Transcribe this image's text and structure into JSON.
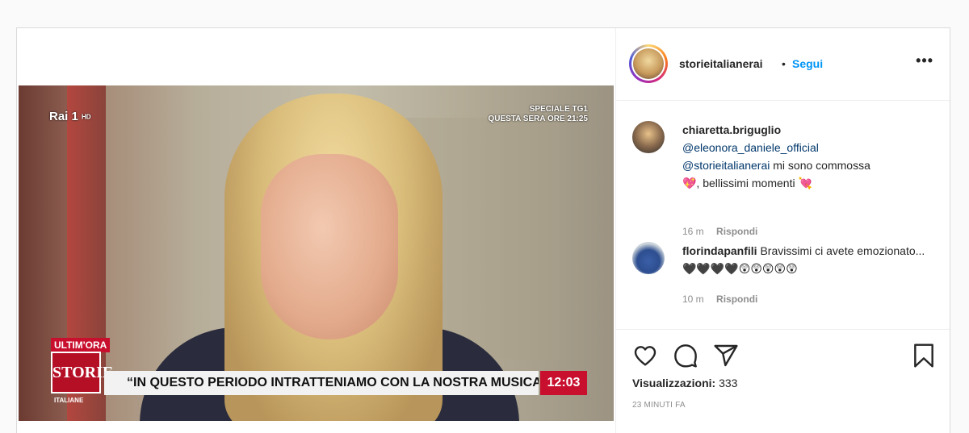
{
  "video": {
    "channel_logo": "Rai 1",
    "channel_hd": "HD",
    "special_line1": "SPECIALE TG1",
    "special_line2": "QUESTA SERA ORE 21:25",
    "breaking_label": "ULTIM'ORA",
    "show_logo": "STORIE",
    "show_logo_sub": "ITALIANE",
    "ticker_text": "“IN QUESTO PERIODO INTRATTENIAMO CON LA NOSTRA MUSICA”",
    "clock": "12:03"
  },
  "header": {
    "username": "storieitalianerai",
    "separator": "•",
    "follow_label": "Segui",
    "more_label": "•••"
  },
  "comments": [
    {
      "user": "chiaretta.briguglio",
      "mention1": "@eleonora_daniele_official",
      "mention2": "@storieitalianerai",
      "text_after_mention": " mi sono commossa",
      "text_line3": "💖, bellissimi momenti 💘",
      "time": "16 m",
      "reply_label": "Rispondi"
    },
    {
      "user": "florindapanfili",
      "text": " Bravissimi ci avete emozionato...🖤🖤🖤🖤😲😲😲😲😲",
      "time": "10 m",
      "reply_label": "Rispondi"
    }
  ],
  "actions": {
    "icons": [
      "heart-icon",
      "comment-icon",
      "share-icon",
      "bookmark-icon"
    ],
    "views_label": "Visualizzazioni:",
    "views_count": "333",
    "timestamp": "23 MINUTI FA"
  }
}
